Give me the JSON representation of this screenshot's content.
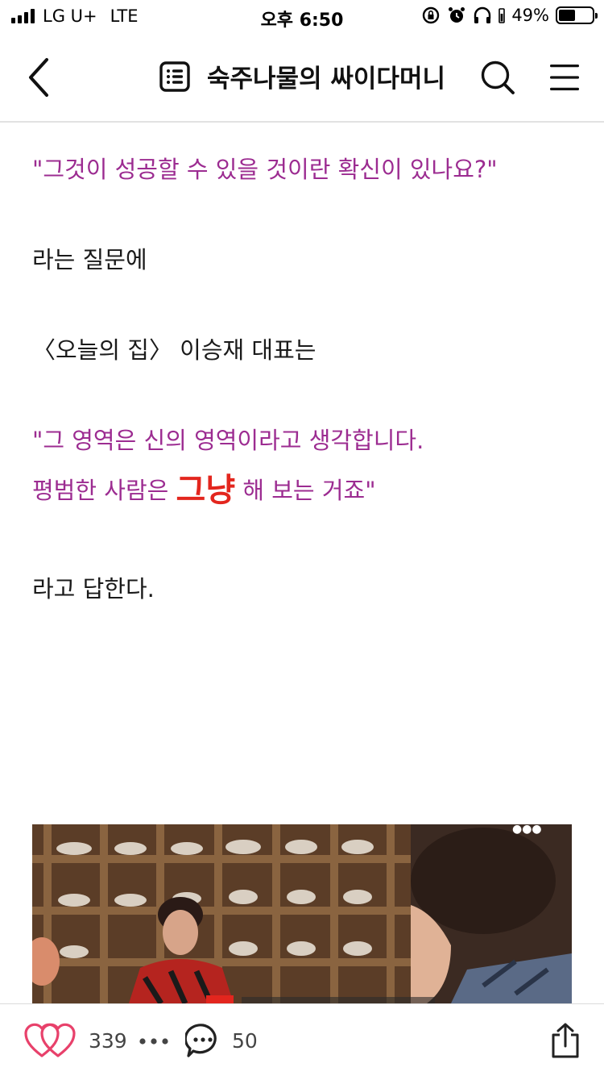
{
  "status_bar": {
    "carrier": "LG U+",
    "network": "LTE",
    "time": "오후 6:50",
    "battery": "49%",
    "battery_level": 0.49
  },
  "header": {
    "title": "숙주나물의 싸이다머니",
    "icons": [
      "chevron-left-icon",
      "list-doc-icon",
      "search-icon",
      "hamburger-menu-icon"
    ]
  },
  "article": {
    "quote_question": "\"그것이 성공할 수 있을 것이란 확신이 있나요?\"",
    "line_question": "라는 질문에",
    "line_speaker": "〈오늘의 집〉 이승재 대표는",
    "quote_answer_1": "\"그 영역은 신의 영역이라고 생각합니다.",
    "quote_answer_2_before": "평범한 사람은 ",
    "quote_answer_2_emphasis": "그냥",
    "quote_answer_2_after": " 해 보는 거죠\"",
    "line_reply": "라고 답한다.",
    "colors": {
      "quote": "#9c2c91",
      "emphasis": "#e3261e",
      "body": "#1a1a1a"
    }
  },
  "bottom_bar": {
    "like_count": "339",
    "comment_count": "50",
    "icons": [
      "heart-icon",
      "more-dots-icon",
      "comment-icon",
      "share-icon"
    ],
    "accent": "#e8416b"
  }
}
